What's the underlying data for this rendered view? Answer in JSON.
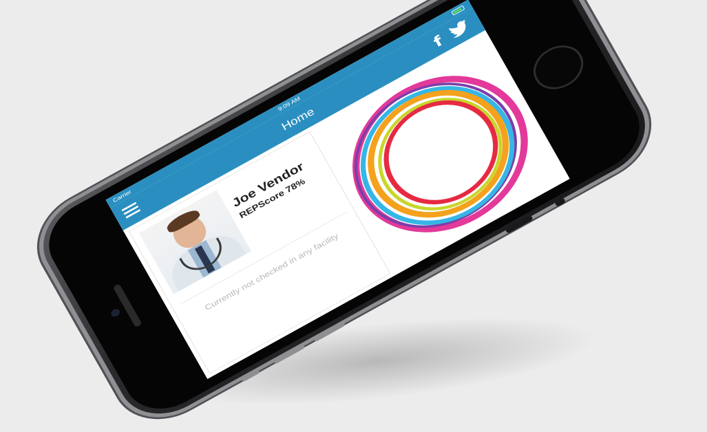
{
  "status_bar": {
    "carrier": "Carrier",
    "time": "9:09 AM"
  },
  "nav": {
    "title": "Home",
    "menu_icon": "hamburger-menu-icon",
    "facebook_label": "f",
    "twitter_icon": "twitter-bird-icon"
  },
  "profile": {
    "name": "Joe Vendor",
    "repscore": "REPScore 78%",
    "checkin_status": "Currently not checked in any facility"
  },
  "colors": {
    "header": "#2a8fc0",
    "ring_colors": [
      "#e2399a",
      "#7a3fa8",
      "#36b6e6",
      "#f4a21d",
      "#c8d62a",
      "#e62a42"
    ]
  }
}
